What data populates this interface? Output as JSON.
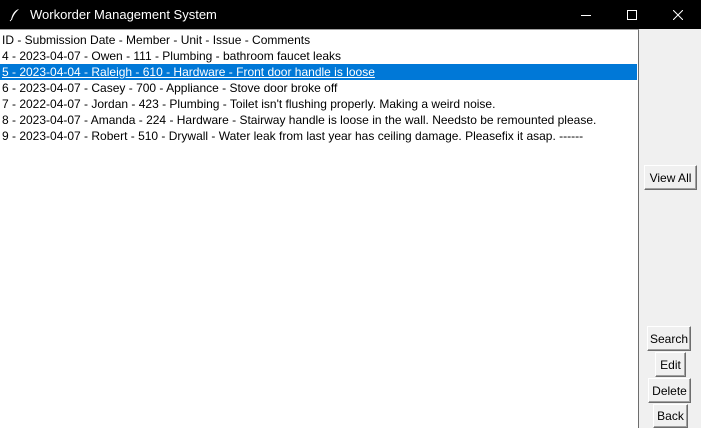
{
  "window": {
    "title": "Workorder Management System",
    "icons": {
      "app": "feather-icon",
      "minimize": "minimize-icon",
      "maximize": "maximize-icon",
      "close": "close-icon"
    }
  },
  "listbox": {
    "items": [
      "ID - Submission Date - Member - Unit - Issue - Comments",
      "4 - 2023-04-07 - Owen - 111 - Plumbing - bathroom faucet leaks",
      "5 - 2023-04-04 - Raleigh - 610 - Hardware - Front door handle is loose",
      "6 - 2023-04-07 - Casey - 700 - Appliance - Stove door broke off",
      "7 - 2022-04-07 - Jordan - 423 - Plumbing - Toilet isn't flushing properly. Making a weird noise.",
      "8 - 2023-04-07 - Amanda - 224 - Hardware - Stairway handle is loose in the wall. Needsto be remounted please.",
      "9 - 2023-04-07 - Robert - 510 - Drywall - Water leak from last year has ceiling damage. Pleasefix it asap. ------"
    ],
    "selected_index": 2,
    "selection_color": "#0078d7"
  },
  "buttons": {
    "view_all": "View All",
    "search": "Search",
    "edit": "Edit",
    "delete": "Delete",
    "back": "Back"
  }
}
